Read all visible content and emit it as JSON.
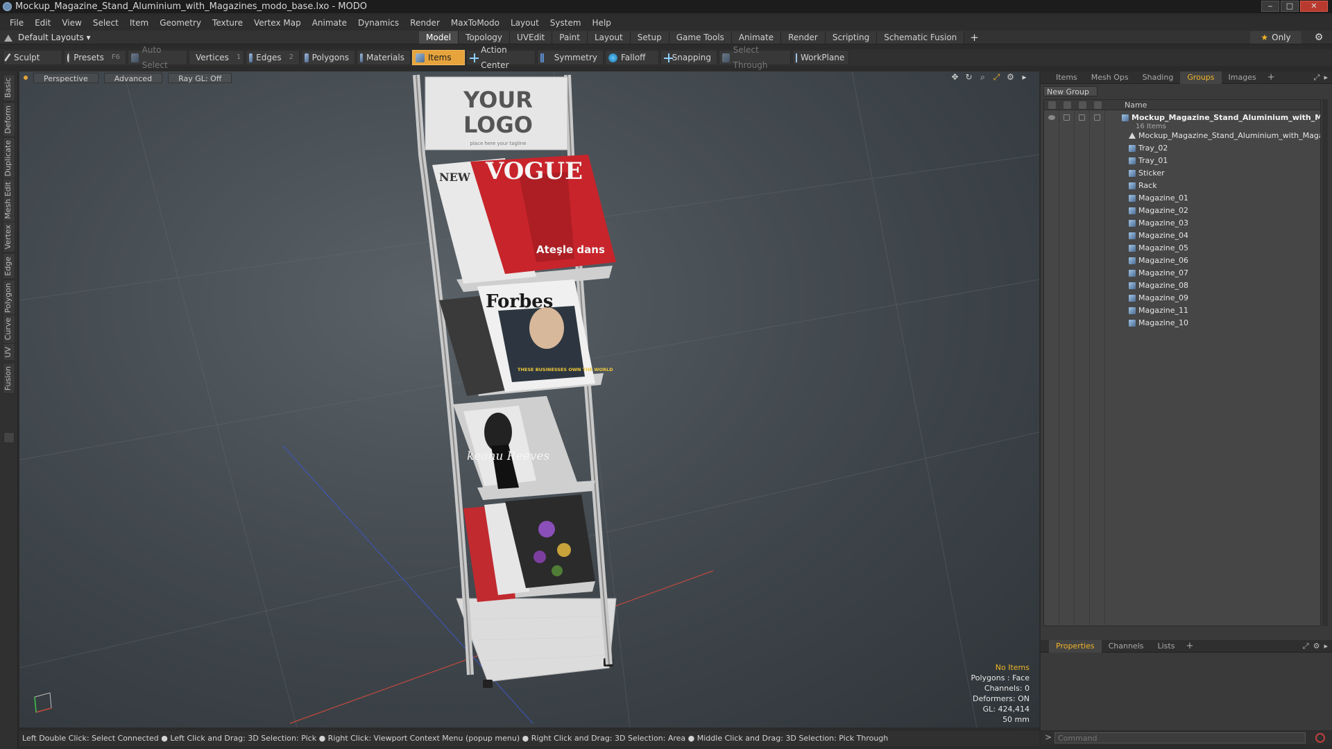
{
  "window": {
    "title": "Mockup_Magazine_Stand_Aluminium_with_Magazines_modo_base.lxo - MODO"
  },
  "menu": [
    "File",
    "Edit",
    "View",
    "Select",
    "Item",
    "Geometry",
    "Texture",
    "Vertex Map",
    "Animate",
    "Dynamics",
    "Render",
    "MaxToModo",
    "Layout",
    "System",
    "Help"
  ],
  "layouts": {
    "label": "Default Layouts ▾"
  },
  "mode_tabs": [
    {
      "label": "Model",
      "active": true
    },
    {
      "label": "Topology"
    },
    {
      "label": "UVEdit"
    },
    {
      "label": "Paint"
    },
    {
      "label": "Layout"
    },
    {
      "label": "Setup"
    },
    {
      "label": "Game Tools"
    },
    {
      "label": "Animate"
    },
    {
      "label": "Render"
    },
    {
      "label": "Scripting"
    },
    {
      "label": "Schematic Fusion"
    }
  ],
  "mode_plus": "+",
  "only_label": "Only",
  "toolbar": {
    "sculpt": "Sculpt",
    "presets": "Presets",
    "presets_key": "F6",
    "auto_select": "Auto Select",
    "vertices": "Vertices",
    "vertices_num": "1",
    "edges": "Edges",
    "edges_num": "2",
    "polygons": "Polygons",
    "materials": "Materials",
    "items": "Items",
    "action_center": "Action Center",
    "symmetry": "Symmetry",
    "falloff": "Falloff",
    "snapping": "Snapping",
    "select_through": "Select Through",
    "workplane": "WorkPlane"
  },
  "left_tabs": [
    "Basic",
    "Deform",
    "Duplicate",
    "Mesh Edit",
    "Vertex",
    "Edge",
    "Polygon",
    "Curve",
    "UV",
    "Fusion"
  ],
  "viewport": {
    "view": "Perspective",
    "shading": "Advanced",
    "raygl": "Ray GL: Off",
    "info": {
      "no_items": "No Items",
      "polygons": "Polygons : Face",
      "channels": "Channels: 0",
      "deformers": "Deformers: ON",
      "gl": "GL: 424,414",
      "scale": "50 mm"
    },
    "sign_text": {
      "line1": "YOUR",
      "line2": "LOGO",
      "tagline": "place here your tagline"
    },
    "magazine_text": {
      "vogue": "VOGUE",
      "new": "NEW",
      "atesle": "Ateşle dans",
      "forbes": "Forbes",
      "forbes_sub": "THESE BUSINESSES OWN THE WORLD",
      "keanu": "keanu Reeves"
    }
  },
  "right_tabs": [
    {
      "label": "Items"
    },
    {
      "label": "Mesh Ops"
    },
    {
      "label": "Shading"
    },
    {
      "label": "Groups",
      "active": true
    },
    {
      "label": "Images"
    }
  ],
  "right_plus": "+",
  "new_group": "New Group",
  "list_header": "Name",
  "groups": {
    "root": "Mockup_Magazine_Stand_Aluminium_with_M...",
    "count": "16 Items",
    "items": [
      {
        "label": "Mockup_Magazine_Stand_Aluminium_with_Magazines",
        "icon": "locator-icon"
      },
      {
        "label": "Tray_02"
      },
      {
        "label": "Tray_01"
      },
      {
        "label": "Sticker"
      },
      {
        "label": "Rack"
      },
      {
        "label": "Magazine_01"
      },
      {
        "label": "Magazine_02"
      },
      {
        "label": "Magazine_03"
      },
      {
        "label": "Magazine_04"
      },
      {
        "label": "Magazine_05"
      },
      {
        "label": "Magazine_06"
      },
      {
        "label": "Magazine_07"
      },
      {
        "label": "Magazine_08"
      },
      {
        "label": "Magazine_09"
      },
      {
        "label": "Magazine_11"
      },
      {
        "label": "Magazine_10"
      }
    ]
  },
  "bottom_tabs": [
    {
      "label": "Properties",
      "active": true
    },
    {
      "label": "Channels"
    },
    {
      "label": "Lists"
    }
  ],
  "bottom_plus": "+",
  "command": {
    "placeholder": "Command",
    "prompt": ">"
  },
  "status": "Left Double Click: Select Connected ● Left Click and Drag: 3D Selection: Pick ● Right Click: Viewport Context Menu (popup menu) ● Right Click and Drag: 3D Selection: Area ● Middle Click and Drag: 3D Selection: Pick Through",
  "colors": {
    "accent": "#e7a43c",
    "active_tab": "#f0b428",
    "close": "#b83a2f"
  }
}
